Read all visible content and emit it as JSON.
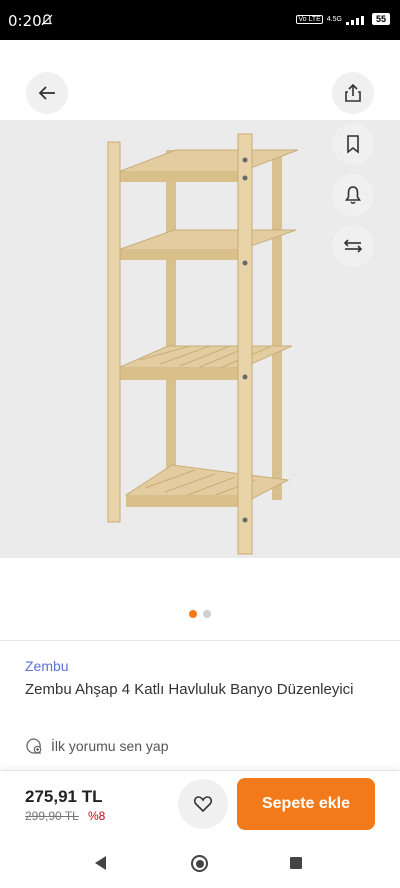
{
  "status_bar": {
    "time": "0:20",
    "volte": "Vo LTE",
    "network": "4.5G",
    "battery": "55"
  },
  "product": {
    "brand": "Zembu",
    "title": "Zembu Ahşap 4 Katlı Havluluk Banyo Düzenleyici",
    "review_prompt": "İlk yorumu sen yap"
  },
  "gallery": {
    "image_count": 2,
    "active_index": 0
  },
  "purchase": {
    "price": "275,91 TL",
    "old_price": "299,90 TL",
    "discount": "%8",
    "add_to_cart_label": "Sepete ekle"
  },
  "colors": {
    "accent": "#f27a1a",
    "brand_link": "#5b72d6",
    "discount": "#d0021b"
  },
  "icons": {
    "back": "arrow-left-icon",
    "share": "share-icon",
    "collection": "bookmark-icon",
    "alert": "bell-icon",
    "compare": "compare-arrows-icon",
    "favorite": "heart-icon",
    "review": "comment-plus-icon"
  }
}
